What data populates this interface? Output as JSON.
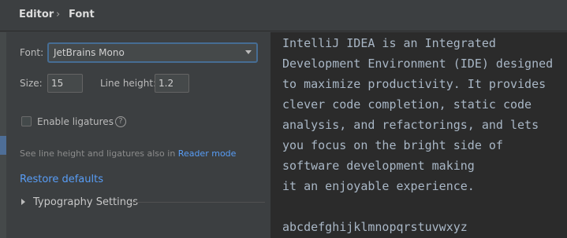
{
  "header": {
    "breadcrumb": [
      "Editor",
      "Font"
    ],
    "separator": "›"
  },
  "settings": {
    "font_label": "Font:",
    "font_value": "JetBrains Mono",
    "size_label": "Size:",
    "size_value": "15",
    "line_height_label": "Line height:",
    "line_height_value": "1.2",
    "ligatures_label": "Enable ligatures",
    "ligatures_checked": false,
    "help_glyph": "?",
    "hint_text": "See line height and ligatures also in",
    "hint_link": "Reader mode",
    "restore_defaults": "Restore defaults",
    "typography_settings": "Typography Settings"
  },
  "preview": {
    "lines": [
      "IntelliJ IDEA is an Integrated",
      "Development Environment (IDE) designed",
      "to maximize productivity. It provides",
      "clever code completion, static code",
      "analysis, and refactorings, and lets",
      "you focus on the bright side of",
      "software development making",
      "it an enjoyable experience.",
      "",
      "abcdefghijklmnopqrstuvwxyz"
    ]
  },
  "colors": {
    "panel_bg": "#3c3f41",
    "preview_bg": "#2b2b2b",
    "link": "#589df6",
    "focus_border": "#466d94"
  }
}
